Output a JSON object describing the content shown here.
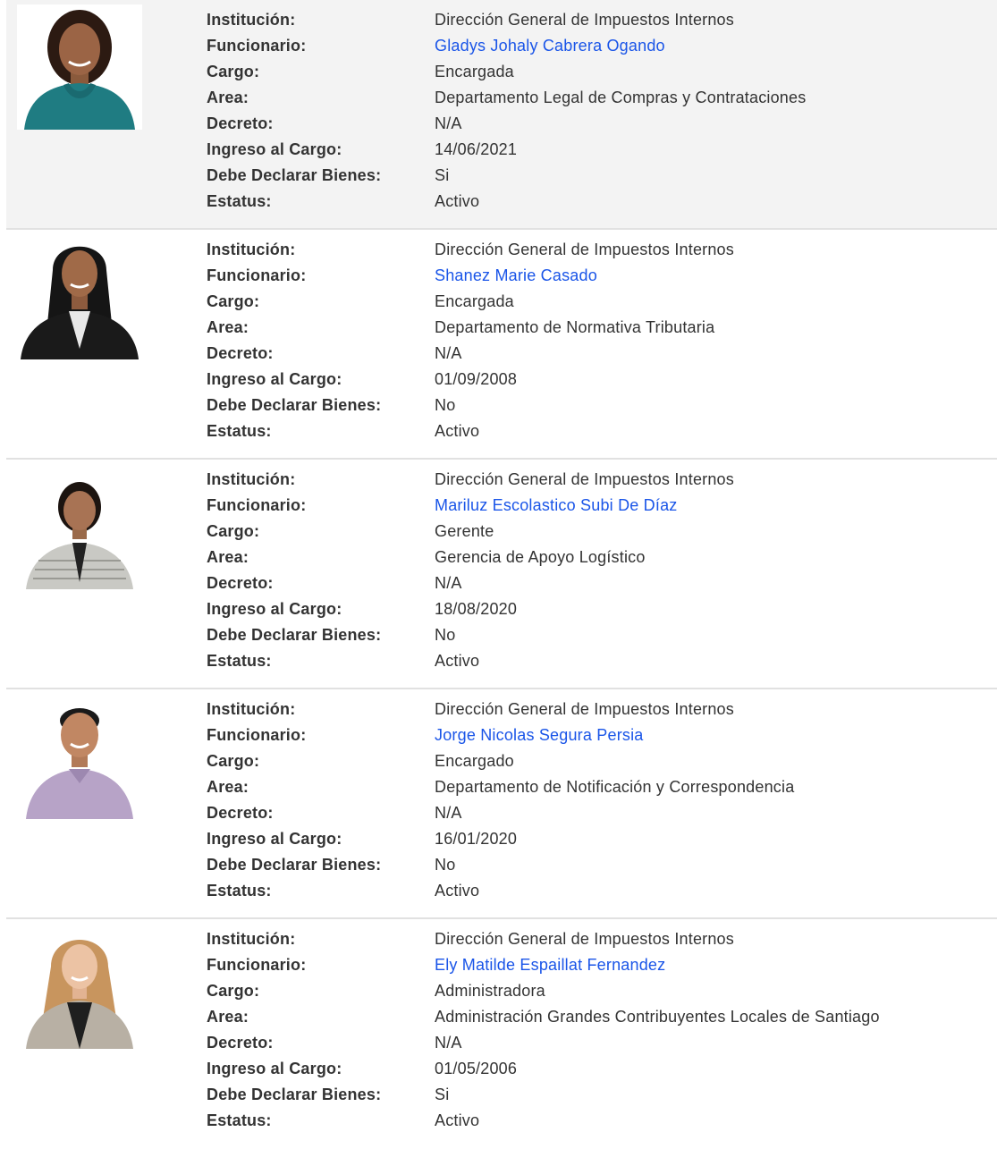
{
  "labels": {
    "institucion": "Institución:",
    "funcionario": "Funcionario:",
    "cargo": "Cargo:",
    "area": "Area:",
    "decreto": "Decreto:",
    "ingreso": "Ingreso al Cargo:",
    "declarar": "Debe Declarar Bienes:",
    "estatus": "Estatus:"
  },
  "colors": {
    "link": "#1a55e8",
    "highlight_row": "#f3f3f3",
    "divider": "#e1e1e1"
  },
  "records": [
    {
      "institucion": "Dirección General de Impuestos Internos",
      "funcionario": "Gladys Johaly Cabrera Ogando",
      "cargo": "Encargada",
      "area": "Departamento Legal de Compras y Contrataciones",
      "decreto": "N/A",
      "ingreso": "14/06/2021",
      "declarar": "Si",
      "estatus": "Activo"
    },
    {
      "institucion": "Dirección General de Impuestos Internos",
      "funcionario": "Shanez Marie Casado",
      "cargo": "Encargada",
      "area": "Departamento de Normativa Tributaria",
      "decreto": "N/A",
      "ingreso": "01/09/2008",
      "declarar": "No",
      "estatus": "Activo"
    },
    {
      "institucion": "Dirección General de Impuestos Internos",
      "funcionario": "Mariluz Escolastico Subi De Díaz",
      "cargo": "Gerente",
      "area": "Gerencia de Apoyo Logístico",
      "decreto": "N/A",
      "ingreso": "18/08/2020",
      "declarar": "No",
      "estatus": "Activo"
    },
    {
      "institucion": "Dirección General de Impuestos Internos",
      "funcionario": "Jorge Nicolas Segura Persia",
      "cargo": "Encargado",
      "area": "Departamento de Notificación y Correspondencia",
      "decreto": "N/A",
      "ingreso": "16/01/2020",
      "declarar": "No",
      "estatus": "Activo"
    },
    {
      "institucion": "Dirección General de Impuestos Internos",
      "funcionario": "Ely Matilde Espaillat Fernandez",
      "cargo": "Administradora",
      "area": "Administración Grandes Contribuyentes Locales de Santiago",
      "decreto": "N/A",
      "ingreso": "01/05/2006",
      "declarar": "Si",
      "estatus": "Activo"
    }
  ]
}
